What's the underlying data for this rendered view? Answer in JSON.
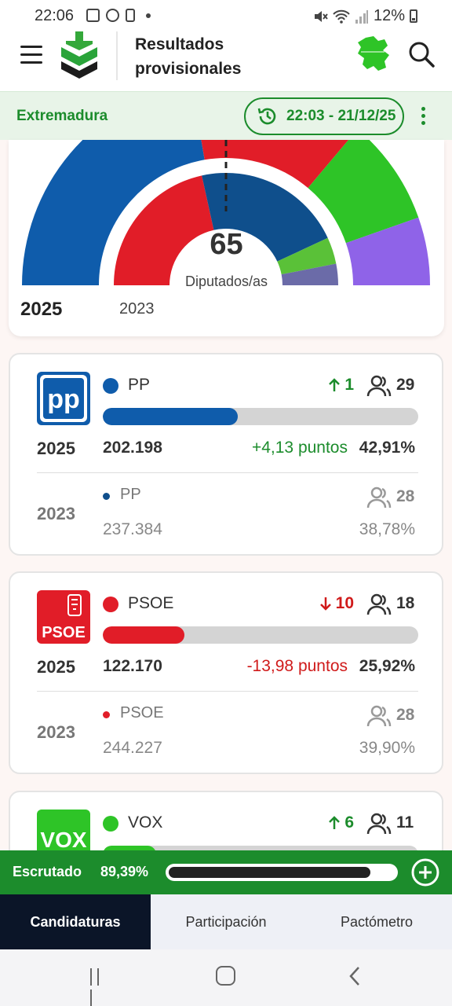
{
  "status_bar": {
    "time": "22:06",
    "battery": "12%"
  },
  "header": {
    "title_line1": "Resultados",
    "title_line2": "provisionales"
  },
  "region_bar": {
    "region": "Extremadura",
    "timestamp": "22:03 - 21/12/25"
  },
  "hemicycle": {
    "total_seats": "65",
    "seats_label": "Diputados/as",
    "year_current": "2025",
    "year_previous": "2023",
    "outer_2025": [
      {
        "party": "PP",
        "seats": 29,
        "color": "#0f5cab"
      },
      {
        "party": "PSOE",
        "seats": 18,
        "color": "#e11d28"
      },
      {
        "party": "VOX",
        "seats": 11,
        "color": "#2ec427"
      },
      {
        "party": "UP",
        "seats": 7,
        "color": "#8f63e8"
      }
    ],
    "inner_2023": [
      {
        "party": "PSOE",
        "seats": 28,
        "color": "#e11d28"
      },
      {
        "party": "PP",
        "seats": 28,
        "color": "#0f4f8c"
      },
      {
        "party": "VOX",
        "seats": 5,
        "color": "#5ac138"
      },
      {
        "party": "UP",
        "seats": 4,
        "color": "#6b6ba8"
      }
    ]
  },
  "parties": [
    {
      "name": "PP",
      "color": "#0f5cab",
      "logo_text": "pp",
      "change_dir": "up",
      "change": "1",
      "change_color": "#1c8c2c",
      "seats": "29",
      "share": 42.91,
      "year": "2025",
      "votes": "202.198",
      "points": "+4,13 puntos",
      "points_color": "#1c8c2c",
      "pct": "42,91%",
      "prev_year": "2023",
      "prev_name": "PP",
      "prev_seats": "28",
      "prev_votes": "237.384",
      "prev_pct": "38,78%"
    },
    {
      "name": "PSOE",
      "color": "#e11d28",
      "logo_text": "PSOE",
      "change_dir": "down",
      "change": "10",
      "change_color": "#d01b1b",
      "seats": "18",
      "share": 25.92,
      "year": "2025",
      "votes": "122.170",
      "points": "-13,98 puntos",
      "points_color": "#d01b1b",
      "pct": "25,92%",
      "prev_year": "2023",
      "prev_name": "PSOE",
      "prev_seats": "28",
      "prev_votes": "244.227",
      "prev_pct": "39,90%"
    },
    {
      "name": "VOX",
      "color": "#2ec427",
      "logo_text": "VOX",
      "change_dir": "up",
      "change": "6",
      "change_color": "#1c8c2c",
      "seats": "11",
      "share": 17
    }
  ],
  "escrutado": {
    "label": "Escrutado",
    "value": "89,39%",
    "fraction": 0.8939
  },
  "tabs": {
    "candidaturas": "Candidaturas",
    "participacion": "Participación",
    "pactometro": "Pactómetro"
  }
}
